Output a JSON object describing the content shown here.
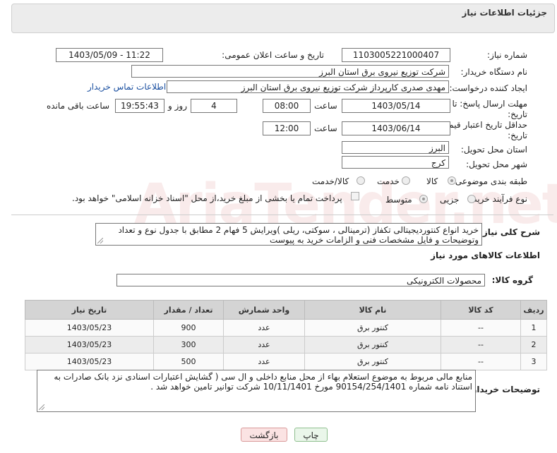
{
  "header": {
    "title": "جزئیات اطلاعات نیاز"
  },
  "form": {
    "need_number_label": "شماره نیاز:",
    "need_number": "1103005221000407",
    "announce_label": "تاریخ و ساعت اعلان عمومی:",
    "announce_value": "1403/05/09 - 11:22",
    "buyer_org_label": "نام دستگاه خریدار:",
    "buyer_org": "شرکت توزیع نیروی برق استان البرز",
    "creator_label": "ایجاد کننده درخواست:",
    "creator": "مهدی صدری کارپرداز شرکت توزیع نیروی برق استان البرز",
    "contact_link": "اطلاعات تماس خریدار",
    "deadline_label_1": "مهلت ارسال پاسخ: تا",
    "deadline_label_2": "تاریخ:",
    "deadline_date": "1403/05/14",
    "time_label": "ساعت",
    "deadline_time": "08:00",
    "days_value": "4",
    "days_label": "روز و",
    "remaining_time": "19:55:43",
    "remaining_label": "ساعت باقی مانده",
    "validity_label_1": "حداقل تاریخ اعتبار قیمت: تا",
    "validity_label_2": "تاریخ:",
    "validity_date": "1403/06/14",
    "validity_time": "12:00",
    "province_label": "استان محل تحویل:",
    "province": "البرز",
    "city_label": "شهر محل تحویل:",
    "city": "کرج",
    "category_label": "طبقه بندی موضوعی:",
    "category_options": [
      "کالا",
      "خدمت",
      "کالا/خدمت"
    ],
    "process_label": "نوع فرآیند خرید :",
    "process_options": [
      "جزیی",
      "متوسط"
    ],
    "payment_note": "پرداخت تمام یا بخشی از مبلغ خرید،از محل \"اسناد خزانه اسلامی\" خواهد بود.",
    "description_label": "شرح کلی نیاز:",
    "description": "خرید انواع کنتوردیجیتالی تکفاز (ترمینالی ، سوکتی، ریلی )ویرایش 5 فهام 2 مطابق با جدول نوع و تعداد وتوضیحات و فایل مشخصات فنی و الزامات خرید به پیوست"
  },
  "goods": {
    "section_title": "اطلاعات کالاهای مورد نیاز",
    "group_label": "گروه کالا:",
    "group_value": "محصولات الکترونیکی",
    "columns": [
      "ردیف",
      "کد کالا",
      "نام کالا",
      "واحد شمارش",
      "تعداد / مقدار",
      "تاریخ نیاز"
    ],
    "rows": [
      [
        "1",
        "--",
        "کنتور برق",
        "عدد",
        "900",
        "1403/05/23"
      ],
      [
        "2",
        "--",
        "کنتور برق",
        "عدد",
        "300",
        "1403/05/23"
      ],
      [
        "3",
        "--",
        "کنتور برق",
        "عدد",
        "500",
        "1403/05/23"
      ]
    ]
  },
  "notes": {
    "label": "توضیحات خریدار:",
    "text": "منابع مالی مربوط به موضوع استعلام بهاء از محل منابع داخلی و ال سی ( گشایش اعتبارات اسنادی نزد بانک صادرات به استناد نامه شماره 90154/254/1401 مورخ 10/11/1401 شرکت توانیر تامین خواهد شد ."
  },
  "buttons": {
    "print": "چاپ",
    "back": "بازگشت"
  },
  "watermark": "AriaTender.net"
}
